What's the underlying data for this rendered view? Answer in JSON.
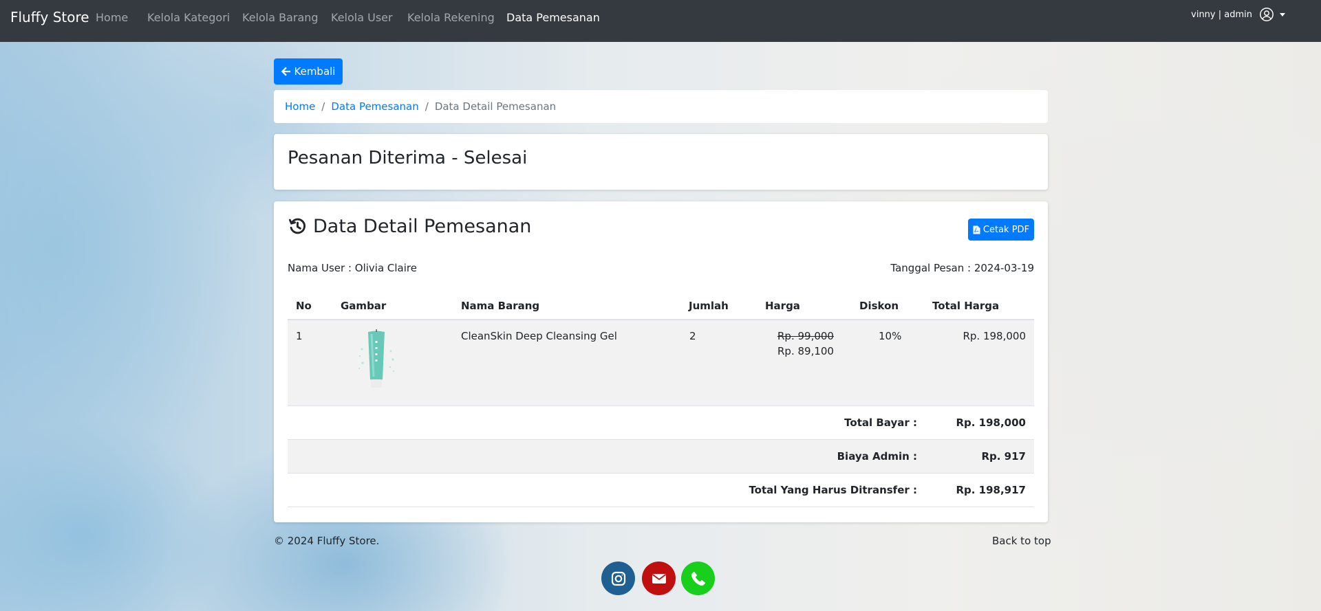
{
  "navbar": {
    "brand": "Fluffy Store",
    "items": [
      {
        "label": "Home",
        "active": false
      },
      {
        "label": "Kelola Kategori",
        "active": false
      },
      {
        "label": "Kelola Barang",
        "active": false
      },
      {
        "label": "Kelola User",
        "active": false
      },
      {
        "label": "Kelola Rekening",
        "active": false
      },
      {
        "label": "Data Pemesanan",
        "active": true
      }
    ],
    "user_label": "vinny | admin",
    "user_icon": "user-circle-icon"
  },
  "back_button": {
    "label": "Kembali",
    "icon": "arrow-left-icon"
  },
  "breadcrumb": {
    "items": [
      "Home",
      "Data Pemesanan"
    ],
    "separator": "/",
    "active": "Data Detail Pemesanan"
  },
  "status": {
    "title": "Pesanan Diterima - Selesai"
  },
  "detail": {
    "icon": "history-icon",
    "title": "Data Detail Pemesanan",
    "pdf_button": {
      "label": "Cetak PDF",
      "icon": "file-pdf-icon"
    },
    "user_name_text": "Nama User : Olivia Claire",
    "order_date_text": "Tanggal Pesan : 2024-03-19",
    "table": {
      "headers": [
        "No",
        "Gambar",
        "Nama Barang",
        "Jumlah",
        "Harga",
        "Diskon",
        "Total Harga"
      ],
      "rows": [
        {
          "no": "1",
          "image": "cleansing-gel-tube",
          "name": "CleanSkin Deep Cleansing Gel",
          "qty": "2",
          "price_old": "Rp. 99,000",
          "price_new": "Rp. 89,100",
          "discount": "10%",
          "total": "Rp. 198,000"
        }
      ],
      "summary": [
        {
          "label": "Total Bayar :",
          "value": "Rp. 198,000"
        },
        {
          "label": "Biaya Admin :",
          "value": "Rp. 917"
        },
        {
          "label": "Total Yang Harus Ditransfer :",
          "value": "Rp. 198,917"
        }
      ]
    }
  },
  "footer": {
    "copyright": "© 2024 Fluffy Store.",
    "back_to_top": "Back to top",
    "social": [
      "instagram-icon",
      "envelope-icon",
      "phone-icon"
    ]
  },
  "colors": {
    "navbar": "#343a40",
    "primary": "#007bff",
    "instagram": "#1f5f91",
    "email": "#c00f10",
    "phone": "#18cf1c"
  }
}
